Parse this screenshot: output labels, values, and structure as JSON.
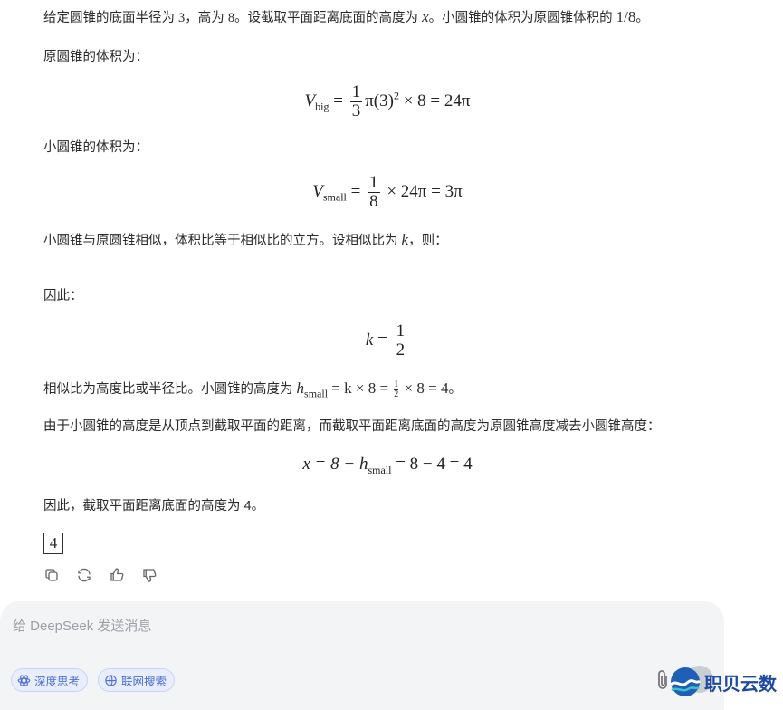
{
  "answer": {
    "intro_a": "给定圆锥的底面半径为 ",
    "intro_r": "3",
    "intro_b": "，高为 ",
    "intro_h": "8",
    "intro_c": "。设截取平面距离底面的高度为 ",
    "intro_x": "x",
    "intro_d": "。小圆锥的体积为原圆锥体积的 ",
    "intro_ratio": "1/8",
    "intro_e": "。",
    "big_label": "原圆锥的体积为：",
    "big_formula_rest": "π(3)",
    "big_formula_tail": "× 8 = 24π",
    "small_label": "小圆锥的体积为：",
    "small_formula_tail": "× 24π = 3π",
    "similar_text_a": "小圆锥与原圆锥相似，体积比等于相似比的立方。设相似比为 ",
    "similar_k": "k",
    "similar_text_b": "，则：",
    "therefore": "因此：",
    "height_text_a": "相似比为高度比或半径比。小圆锥的高度为 ",
    "height_text_b": "。",
    "reason_text": "由于小圆锥的高度是从顶点到截取平面的距离，而截取平面距离底面的高度为原圆锥高度减去小圆锥高度：",
    "conclusion": "因此，截取平面距离底面的高度为 4。",
    "boxed_answer": "4"
  },
  "math": {
    "V": "V",
    "big_sub": "big",
    "small_sub": "small",
    "one": "1",
    "three": "3",
    "eight": "8",
    "two": "2",
    "sq": "2",
    "eq": "=",
    "k": "k",
    "h": "h",
    "x_expr_a": "x = 8 −",
    "x_expr_b": "= 8 − 4 = 4",
    "h_expr": "= k × 8 =",
    "h_expr_tail": "× 8 = 4"
  },
  "actions": {
    "copy": "copy-icon",
    "regenerate": "refresh-icon",
    "like": "thumbs-up-icon",
    "dislike": "thumbs-down-icon"
  },
  "composer": {
    "placeholder": "给 DeepSeek 发送消息",
    "deep_think": "深度思考",
    "web_search": "联网搜索"
  },
  "watermark": {
    "text": "职贝云数"
  },
  "colors": {
    "pill_bg": "#e8eefc",
    "pill_text": "#4c6fd3",
    "composer_bg": "#f3f4f6",
    "brand": "#1d4aa0"
  }
}
